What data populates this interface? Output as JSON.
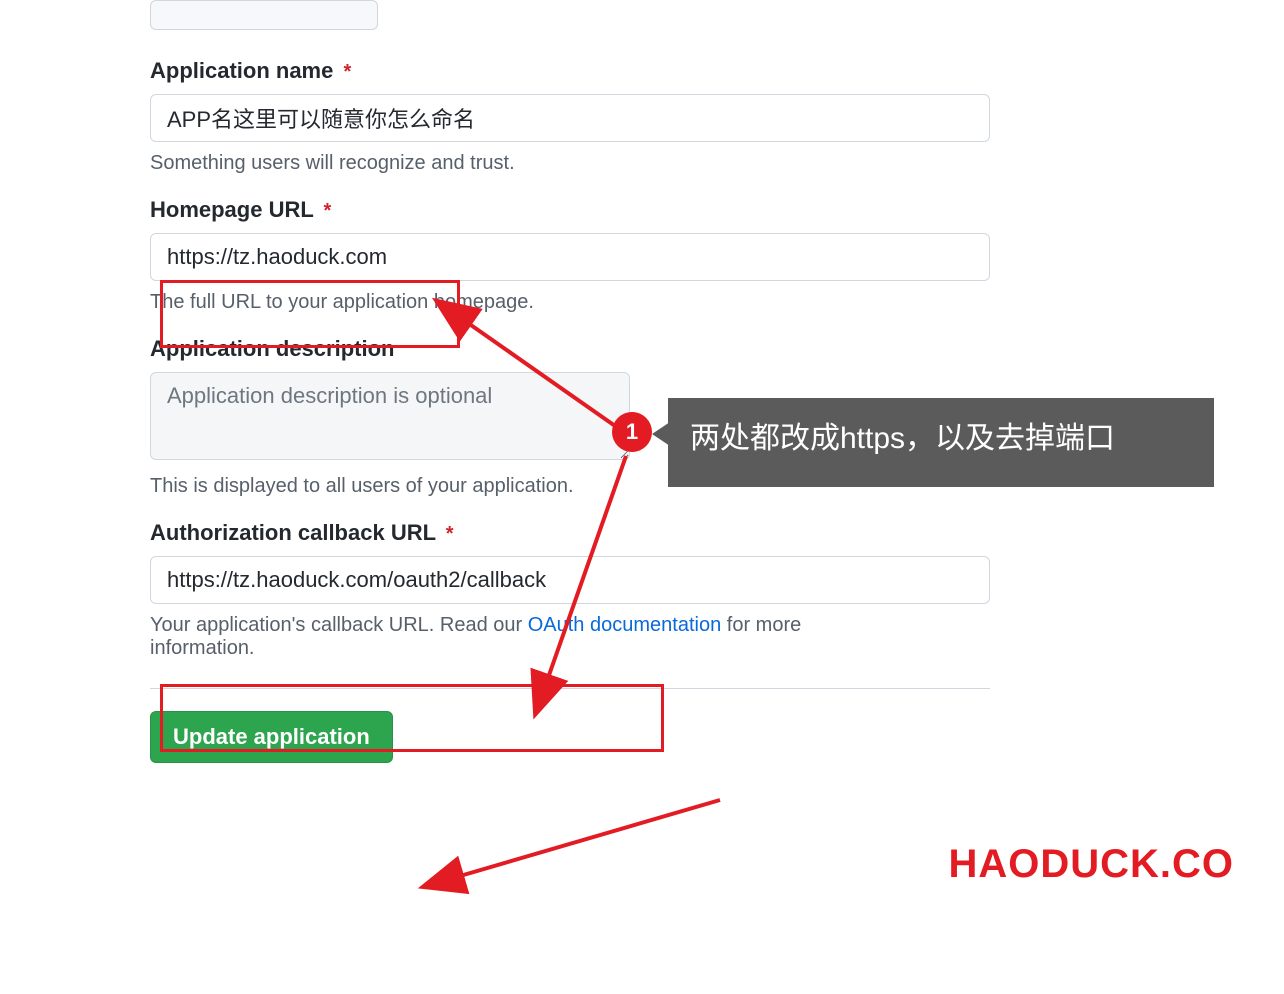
{
  "fields": {
    "appName": {
      "label": "Application name",
      "value": "APP名这里可以随意你怎么命名",
      "help": "Something users will recognize and trust."
    },
    "homepageUrl": {
      "label": "Homepage URL",
      "value": "https://tz.haoduck.com",
      "help": "The full URL to your application homepage."
    },
    "description": {
      "label": "Application description",
      "placeholder": "Application description is optional",
      "help": "This is displayed to all users of your application."
    },
    "callbackUrl": {
      "label": "Authorization callback URL",
      "value": "https://tz.haoduck.com/oauth2/callback",
      "helpPrefix": "Your application's callback URL. Read our ",
      "linkText": "OAuth documentation",
      "helpSuffix": " for more information."
    }
  },
  "buttons": {
    "update": "Update application"
  },
  "annotation": {
    "badgeNumber": "1",
    "tooltipText": "两处都改成https，以及去掉端口"
  },
  "watermark": "HAODUCK.CO",
  "requiredMark": "*"
}
